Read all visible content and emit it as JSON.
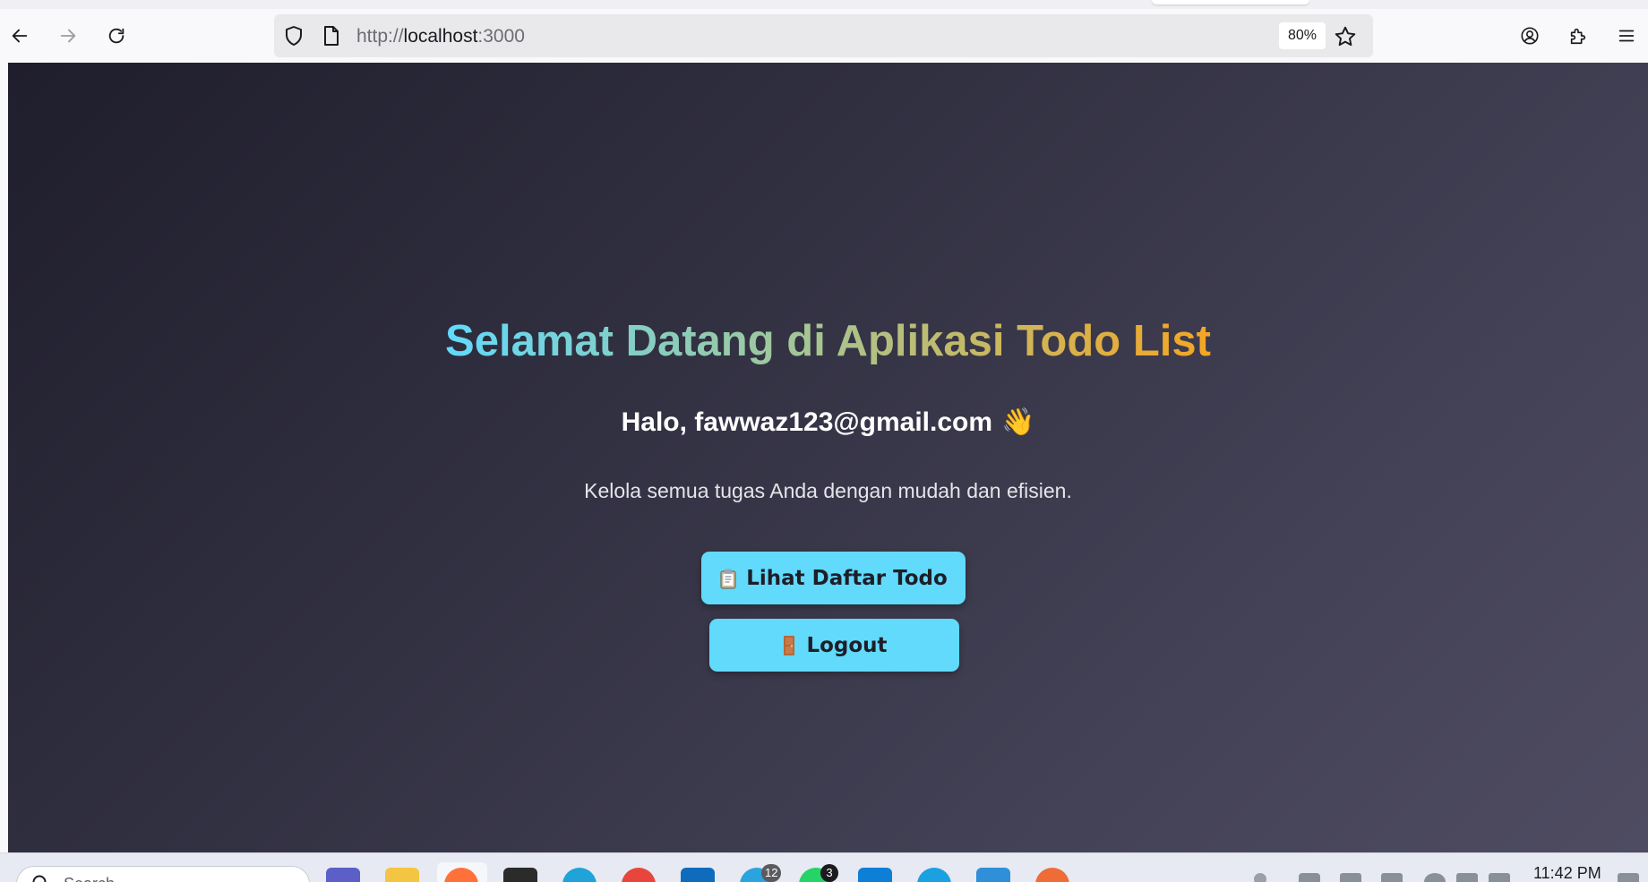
{
  "browser": {
    "url_prefix": "http://",
    "url_host": "localhost",
    "url_port": ":3000",
    "zoom": "80%"
  },
  "page": {
    "title": "Selamat Datang di Aplikasi Todo List",
    "greeting": "Halo, fawwaz123@gmail.com",
    "greeting_emoji": "👋",
    "subtitle": "Kelola semua tugas Anda dengan mudah dan efisien.",
    "todo_button_label": "Lihat Daftar Todo",
    "logout_button_label": "Logout"
  },
  "colors": {
    "accent": "#61dafb",
    "title_gradient": [
      "#61dafb",
      "#a9c48e",
      "#f5a623"
    ],
    "background_start": "#1f1e2c",
    "background_end": "#4f4c62"
  },
  "taskbar": {
    "search_placeholder": "Search",
    "clock": "11:42 PM",
    "badges": [
      "12",
      "3"
    ],
    "apps": [
      "teams-icon",
      "file-explorer-icon",
      "firefox-icon",
      "terminal-icon",
      "edge-icon",
      "chrome-icon",
      "outlook-icon",
      "telegram-icon",
      "whatsapp-icon",
      "vscode-icon",
      "cloud-app-icon",
      "notepad-icon",
      "postman-icon"
    ]
  }
}
